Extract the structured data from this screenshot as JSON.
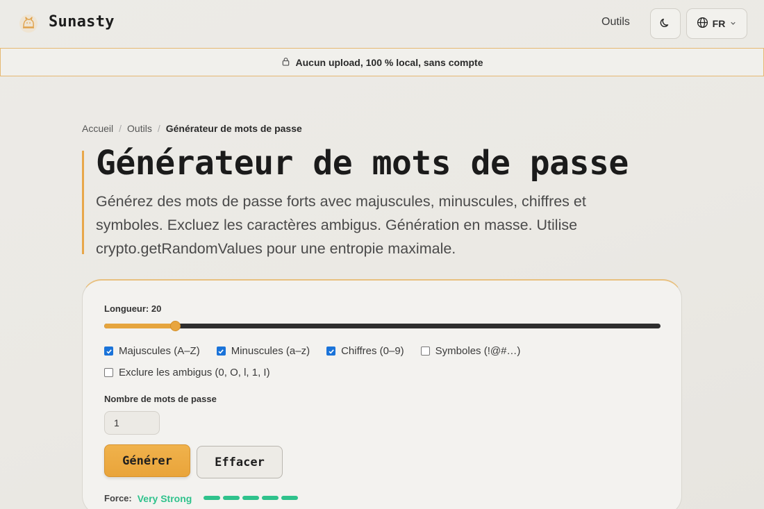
{
  "header": {
    "brand": "Sunasty",
    "nav_tools": "Outils",
    "language": "FR"
  },
  "banner": {
    "text": "Aucun upload, 100 % local, sans compte"
  },
  "breadcrumb": {
    "home": "Accueil",
    "tools": "Outils",
    "current": "Générateur de mots de passe",
    "separator": "/"
  },
  "hero": {
    "title": "Générateur de mots de passe",
    "description": "Générez des mots de passe forts avec majuscules, minuscules, chiffres et symboles. Excluez les caractères ambigus. Génération en masse. Utilise crypto.getRandomValues pour une entropie maximale."
  },
  "generator": {
    "length_label": "Longueur: 20",
    "length_value": 20,
    "length_min": 4,
    "length_max": 128,
    "options": [
      {
        "label": "Majuscules (A–Z)",
        "checked": true
      },
      {
        "label": "Minuscules (a–z)",
        "checked": true
      },
      {
        "label": "Chiffres (0–9)",
        "checked": true
      },
      {
        "label": "Symboles (!@#…)",
        "checked": false
      }
    ],
    "exclude_ambiguous": {
      "label": "Exclure les ambigus (0, O, l, 1, I)",
      "checked": false
    },
    "count_label": "Nombre de mots de passe",
    "count_value": "1",
    "generate_label": "Générer",
    "clear_label": "Effacer",
    "strength_label": "Force:",
    "strength_value": "Very Strong",
    "strength_level": 5,
    "strength_max": 5
  },
  "colors": {
    "accent": "#e8a53f",
    "strength": "#2fc28c",
    "checkbox": "#1a73d9"
  },
  "icons": {
    "logo": "cat-logo-icon",
    "theme": "moon-icon",
    "language": "globe-icon",
    "dropdown": "chevron-down-icon",
    "banner": "lock-icon"
  }
}
